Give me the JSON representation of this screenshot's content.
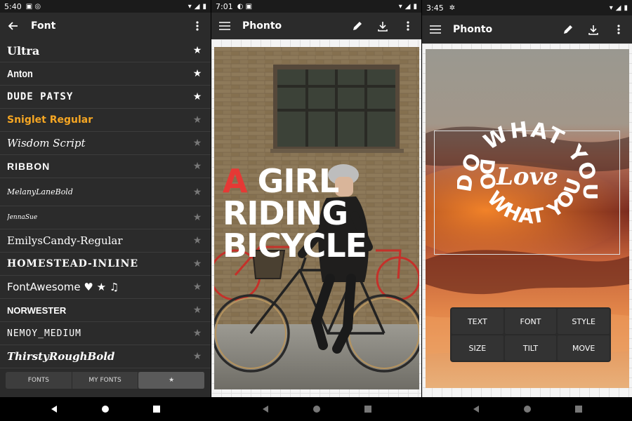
{
  "left": {
    "status": {
      "time": "5:40"
    },
    "appbar": {
      "title": "Font"
    },
    "fonts": [
      {
        "name": "Ultra",
        "fav": true
      },
      {
        "name": "Anton",
        "fav": true
      },
      {
        "name": "DUDE PATSY",
        "fav": true
      },
      {
        "name": "Sniglet Regular",
        "fav": false,
        "color": "#f5a623"
      },
      {
        "name": "Wisdom Script",
        "fav": false
      },
      {
        "name": "RIBBON",
        "fav": false
      },
      {
        "name": "MelanyLaneBold",
        "fav": false
      },
      {
        "name": "JennaSue",
        "fav": false
      },
      {
        "name": "EmilysCandy-Regular",
        "fav": false
      },
      {
        "name": "HOMESTEAD-INLINE",
        "fav": false
      },
      {
        "name": "FontAwesome ♥ ★ ♫",
        "fav": false
      },
      {
        "name": "NORWESTER",
        "fav": false
      },
      {
        "name": "NEMOY_MEDIUM",
        "fav": false
      },
      {
        "name": "ThirstyRoughBold",
        "fav": false
      }
    ],
    "tabs": {
      "fonts": "FONTS",
      "my_fonts": "MY FONTS",
      "favorites": "★"
    }
  },
  "middle": {
    "status": {
      "time": "7:01"
    },
    "appbar": {
      "title": "Phonto"
    },
    "overlay": {
      "line1_accent": "A",
      "line1_rest": " GIRL",
      "line2": "RIDING",
      "line3": "BICYCLE"
    }
  },
  "right": {
    "status": {
      "time": "3:45"
    },
    "appbar": {
      "title": "Phonto"
    },
    "overlay": {
      "arc_top": "DO WHAT YOU",
      "arc_bottom": "DO WHAT YOU DO",
      "center": "Love"
    },
    "menu": [
      "TEXT",
      "FONT",
      "STYLE",
      "SIZE",
      "TILT",
      "MOVE"
    ]
  },
  "icons": {
    "back": "arrow-left-icon",
    "overflow": "more-vert-icon",
    "menu": "hamburger-icon",
    "edit": "pencil-icon",
    "download": "download-icon"
  },
  "colors": {
    "toolbar": "#2b2b2b",
    "accent_red": "#e53935",
    "sniglet_orange": "#f5a623"
  }
}
